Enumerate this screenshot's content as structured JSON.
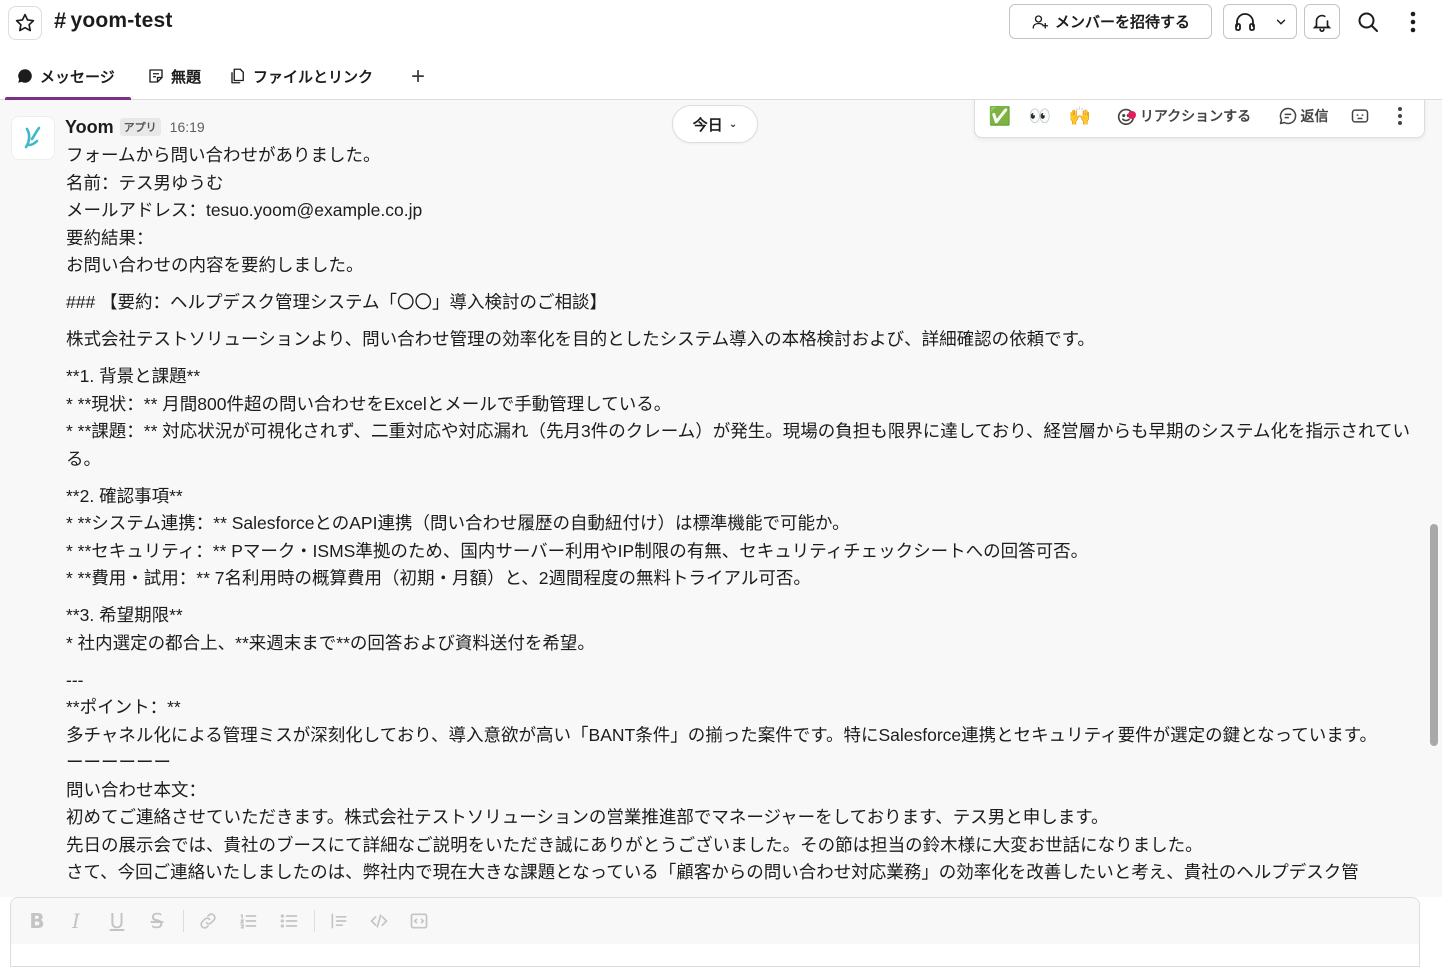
{
  "header": {
    "channel_hash": "#",
    "channel_name": "yoom-test",
    "invite_label": "メンバーを招待する"
  },
  "tabs": [
    {
      "label": "メッセージ",
      "active": true
    },
    {
      "label": "無題",
      "active": false
    },
    {
      "label": "ファイルとリンク",
      "active": false
    }
  ],
  "tab_add": "+",
  "date_pill": {
    "label": "今日",
    "chevron": "⌄"
  },
  "action_bar": {
    "emoji_1": "✅",
    "emoji_2": "👀",
    "emoji_3": "🙌",
    "reaction_label": "リアクションする",
    "reply_label": "返信"
  },
  "message": {
    "sender": "Yoom",
    "badge": "アプリ",
    "time": "16:19",
    "lines": {
      "l1": "フォームから問い合わせがありました。",
      "l2": "名前：テス男ゆうむ",
      "l3": "メールアドレス：tesuo.yoom@example.co.jp",
      "l4": "要約結果：",
      "l5": "お問い合わせの内容を要約しました。",
      "l6": "### 【要約：ヘルプデスク管理システム「〇〇」導入検討のご相談】",
      "l7": "株式会社テストソリューションより、問い合わせ管理の効率化を目的としたシステム導入の本格検討および、詳細確認の依頼です。",
      "l8": "**1. 背景と課題**",
      "l9": "*   **現状：** 月間800件超の問い合わせをExcelとメールで手動管理している。",
      "l10": "*   **課題：** 対応状況が可視化されず、二重対応や対応漏れ（先月3件のクレーム）が発生。現場の負担も限界に達しており、経営層からも早期のシステム化を指示されている。",
      "l11": "**2. 確認事項**",
      "l12": "*   **システム連携：** SalesforceとのAPI連携（問い合わせ履歴の自動紐付け）は標準機能で可能か。",
      "l13": "*   **セキュリティ：** Pマーク・ISMS準拠のため、国内サーバー利用やIP制限の有無、セキュリティチェックシートへの回答可否。",
      "l14": "*   **費用・試用：** 7名利用時の概算費用（初期・月額）と、2週間程度の無料トライアル可否。",
      "l15": "**3. 希望期限**",
      "l16": "*   社内選定の都合上、**来週末まで**の回答および資料送付を希望。",
      "l17": "---",
      "l18": "**ポイント：**",
      "l19": "多チャネル化による管理ミスが深刻化しており、導入意欲が高い「BANT条件」の揃った案件です。特にSalesforce連携とセキュリティ要件が選定の鍵となっています。",
      "l20": "ーーーーーー",
      "l21": "問い合わせ本文：",
      "l22": "初めてご連絡させていただきます。株式会社テストソリューションの営業推進部でマネージャーをしております、テス男と申します。",
      "l23": "先日の展示会では、貴社のブースにて詳細なご説明をいただき誠にありがとうございました。その節は担当の鈴木様に大変お世話になりました。",
      "l24": "さて、今回ご連絡いたしましたのは、弊社内で現在大きな課題となっている「顧客からの問い合わせ対応業務」の効率化を改善したいと考え、貴社のヘルプデスク管"
    }
  },
  "composer": {
    "bold": "B",
    "italic": "I",
    "underline": "U",
    "strike": "S"
  }
}
